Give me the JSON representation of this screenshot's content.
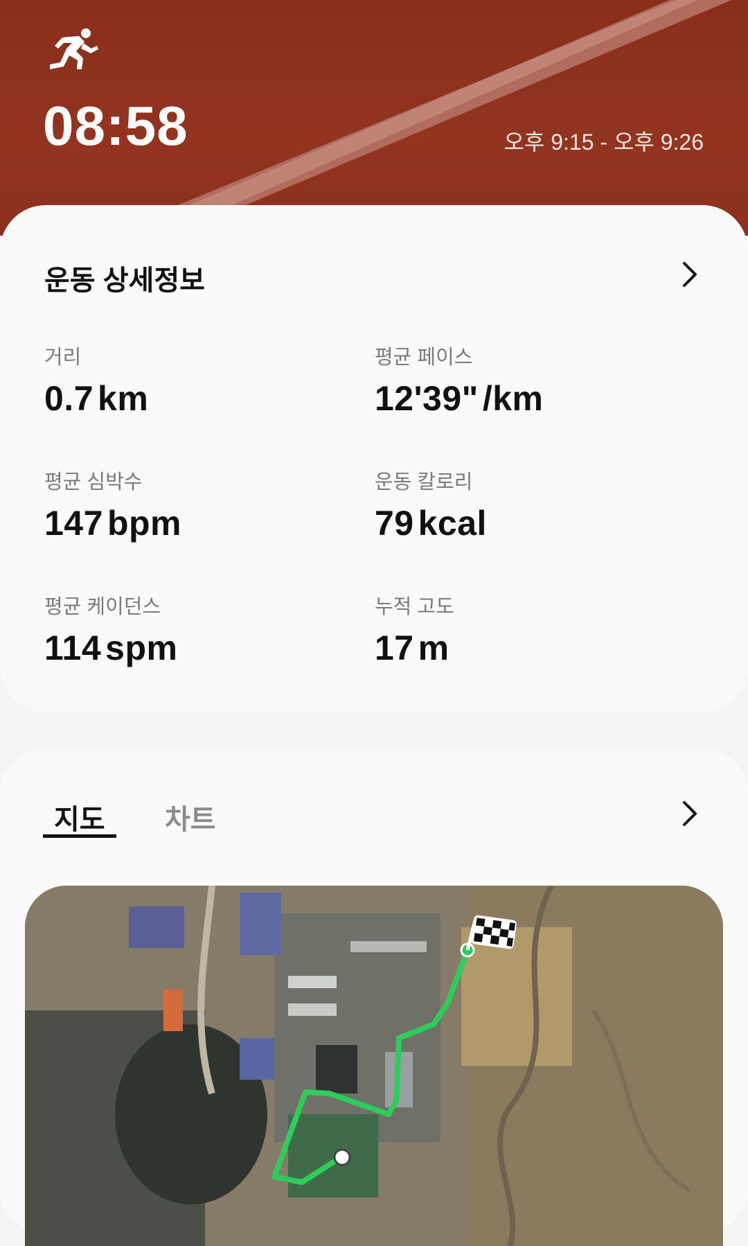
{
  "header": {
    "duration": "08:58",
    "time_range": "오후 9:15 - 오후 9:26",
    "icon": "running-person-icon"
  },
  "details": {
    "title": "운동 상세정보",
    "metrics": [
      {
        "label": "거리",
        "value": "0.7",
        "unit": "km"
      },
      {
        "label": "평균 페이스",
        "value": "12'39\"",
        "unit": "/km"
      },
      {
        "label": "평균 심박수",
        "value": "147",
        "unit": "bpm"
      },
      {
        "label": "운동 칼로리",
        "value": "79",
        "unit": "kcal"
      },
      {
        "label": "평균 케이던스",
        "value": "114",
        "unit": "spm"
      },
      {
        "label": "누적 고도",
        "value": "17",
        "unit": "m"
      }
    ]
  },
  "tabs": {
    "map_label": "지도",
    "chart_label": "차트",
    "active": "지도"
  },
  "colors": {
    "hero_background": "#8a2e1c",
    "route": "#2ecc5a",
    "card_background": "#fafafa"
  }
}
